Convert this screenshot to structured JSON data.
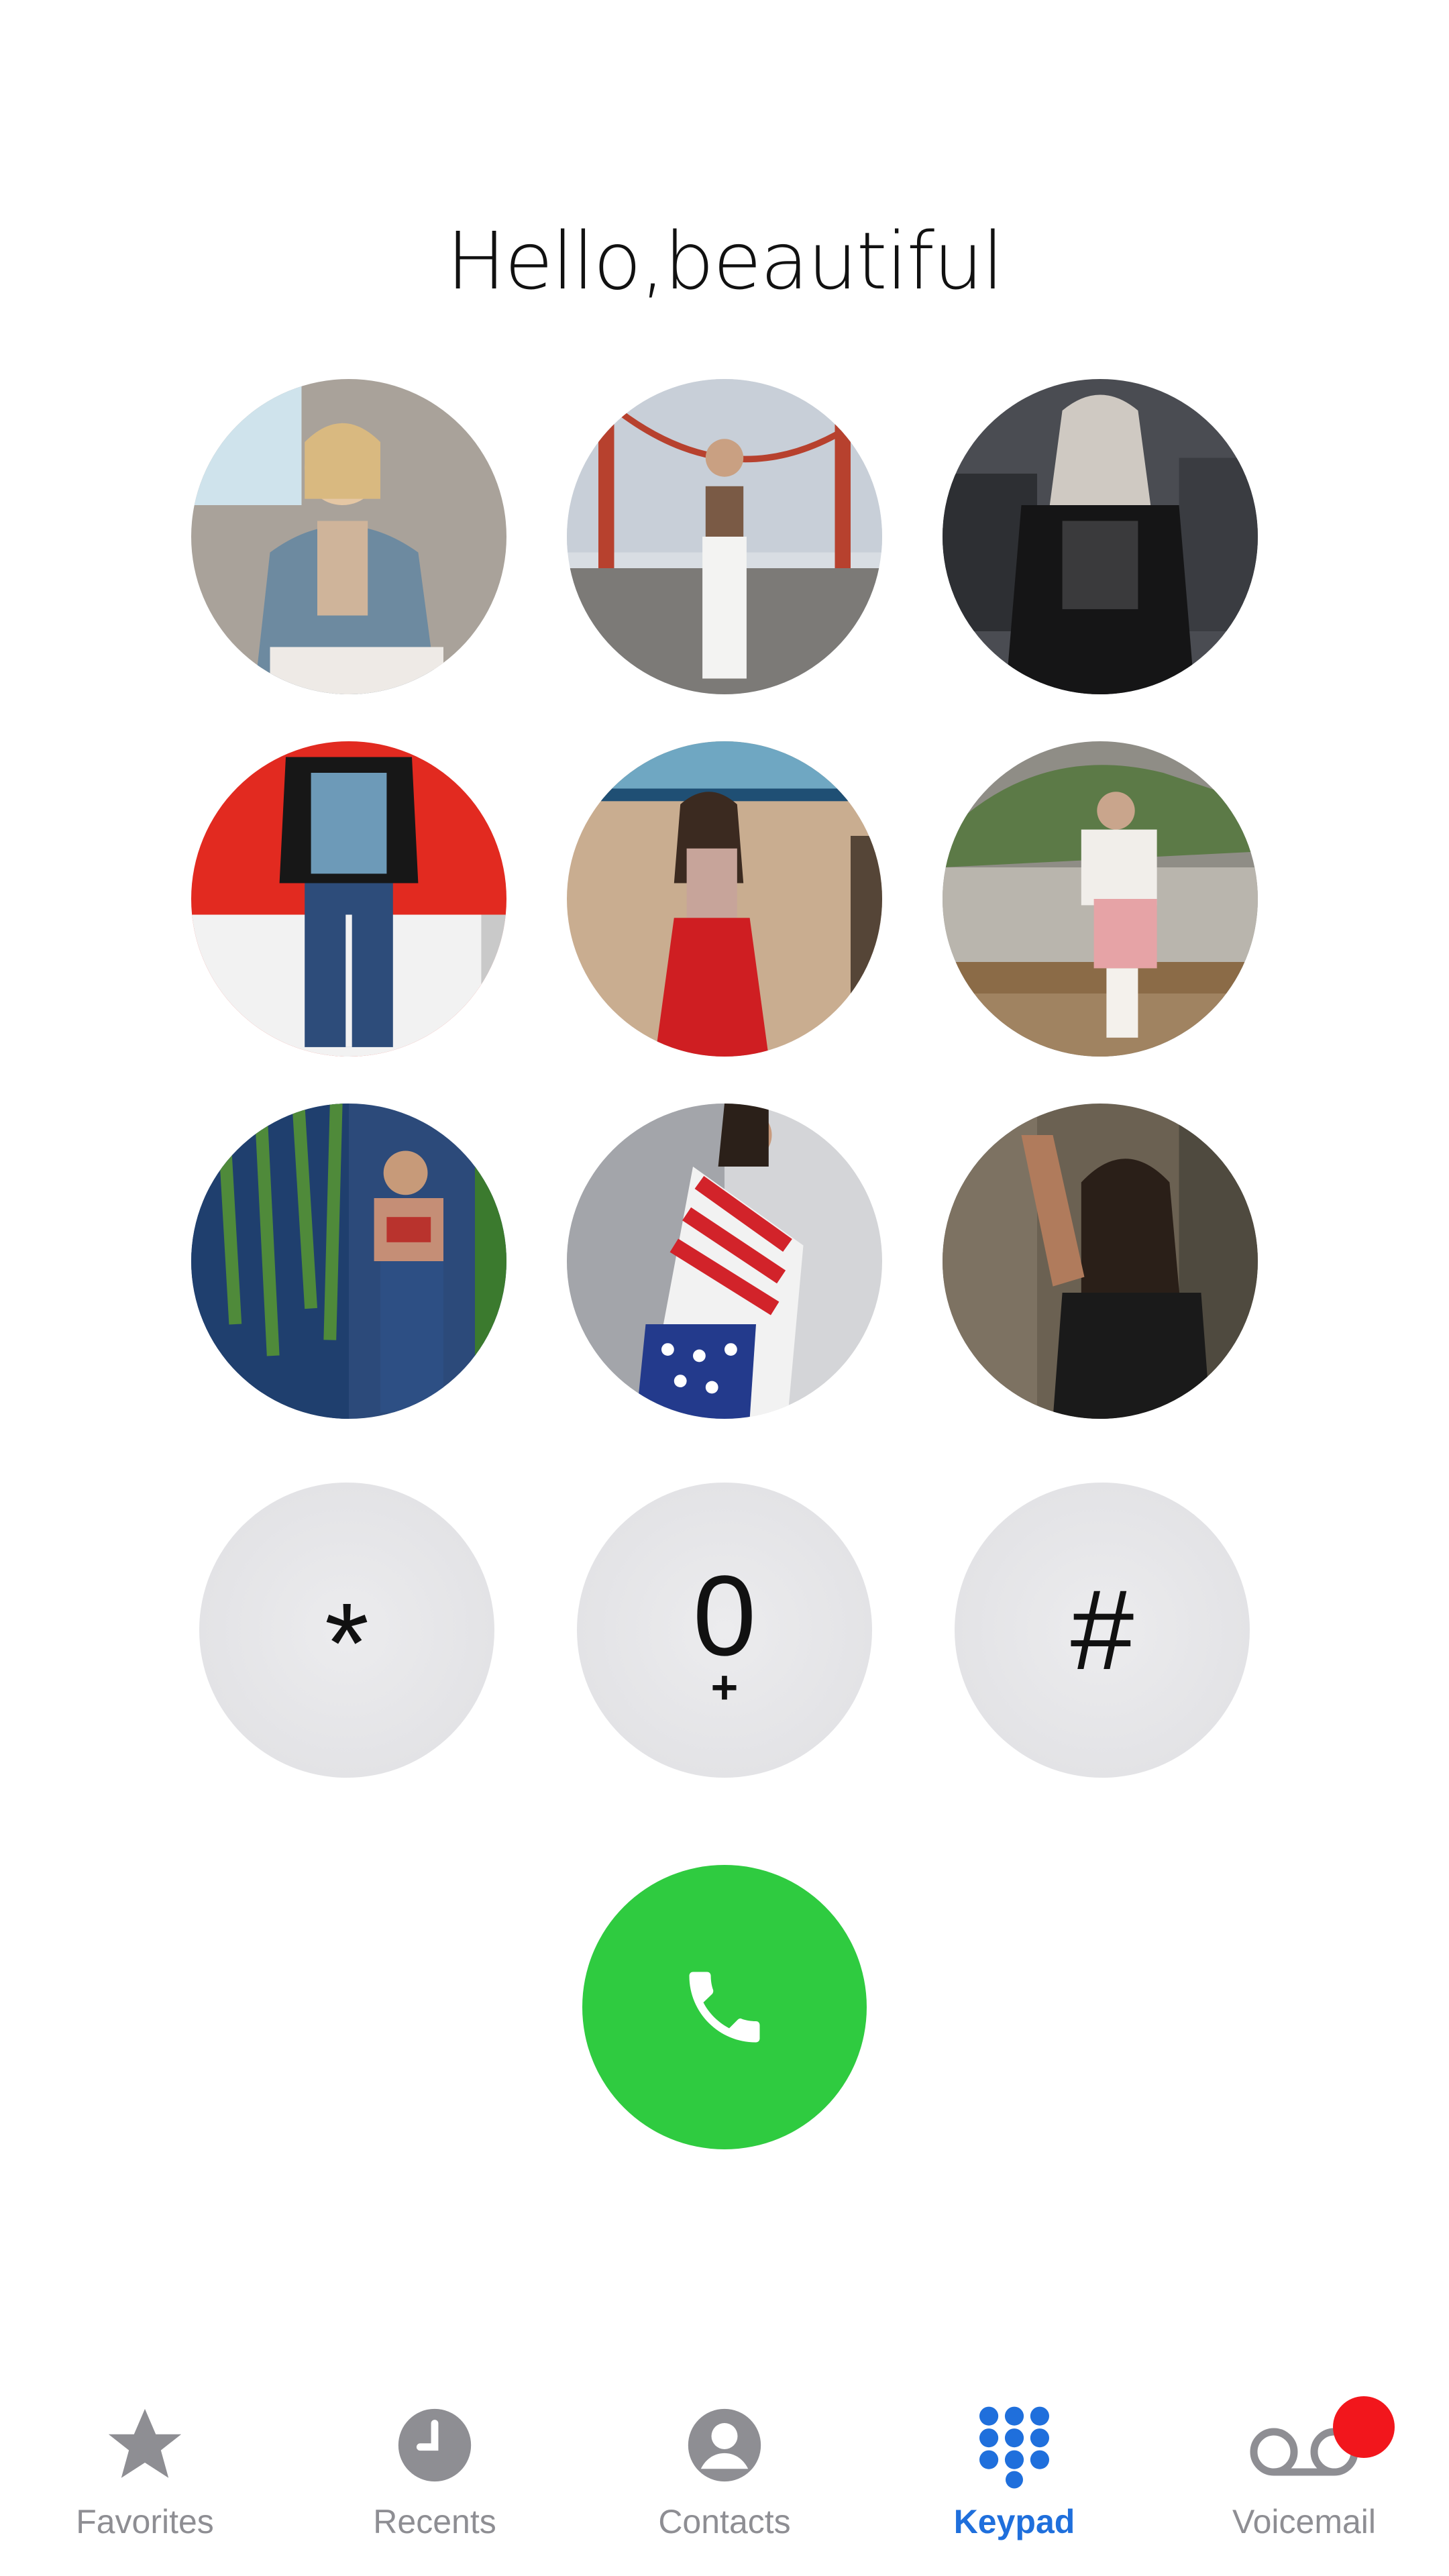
{
  "header": {
    "greeting": "Hello,beautiful"
  },
  "photos": [
    {
      "name": "photo-1"
    },
    {
      "name": "photo-2"
    },
    {
      "name": "photo-3"
    },
    {
      "name": "photo-4"
    },
    {
      "name": "photo-5"
    },
    {
      "name": "photo-6"
    },
    {
      "name": "photo-7"
    },
    {
      "name": "photo-8"
    },
    {
      "name": "photo-9"
    }
  ],
  "keypad": {
    "star": "*",
    "zero": "0",
    "zero_sub": "+",
    "hash": "#"
  },
  "call_button": {
    "icon": "phone-icon",
    "color": "#2fcb40"
  },
  "tabbar": {
    "items": [
      {
        "label": "Favorites",
        "icon": "star-icon"
      },
      {
        "label": "Recents",
        "icon": "clock-icon"
      },
      {
        "label": "Contacts",
        "icon": "person-icon"
      },
      {
        "label": "Keypad",
        "icon": "keypad-grid-icon",
        "active": true
      },
      {
        "label": "Voicemail",
        "icon": "voicemail-icon",
        "badge": true
      }
    ],
    "active_color": "#1f6fdc",
    "inactive_color": "#8e8e93",
    "badge_color": "#f2161c"
  }
}
